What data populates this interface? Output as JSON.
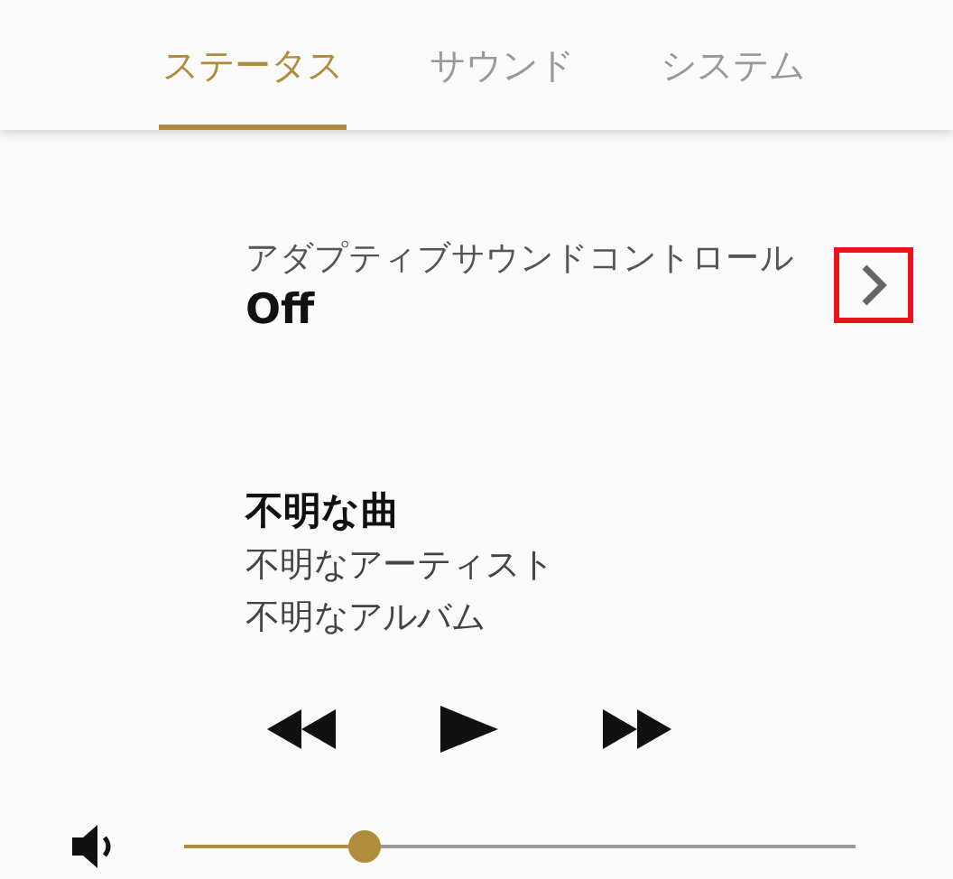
{
  "tabs": [
    {
      "label": "ステータス",
      "selected": true
    },
    {
      "label": "サウンド",
      "selected": false
    },
    {
      "label": "システム",
      "selected": false
    }
  ],
  "setting": {
    "label": "アダプティブサウンドコントロール",
    "value": "Off",
    "highlighted": true
  },
  "track": {
    "title": "不明な曲",
    "artist": "不明なアーティスト",
    "album": "不明なアルバム"
  },
  "volume": {
    "level": 0.27
  }
}
